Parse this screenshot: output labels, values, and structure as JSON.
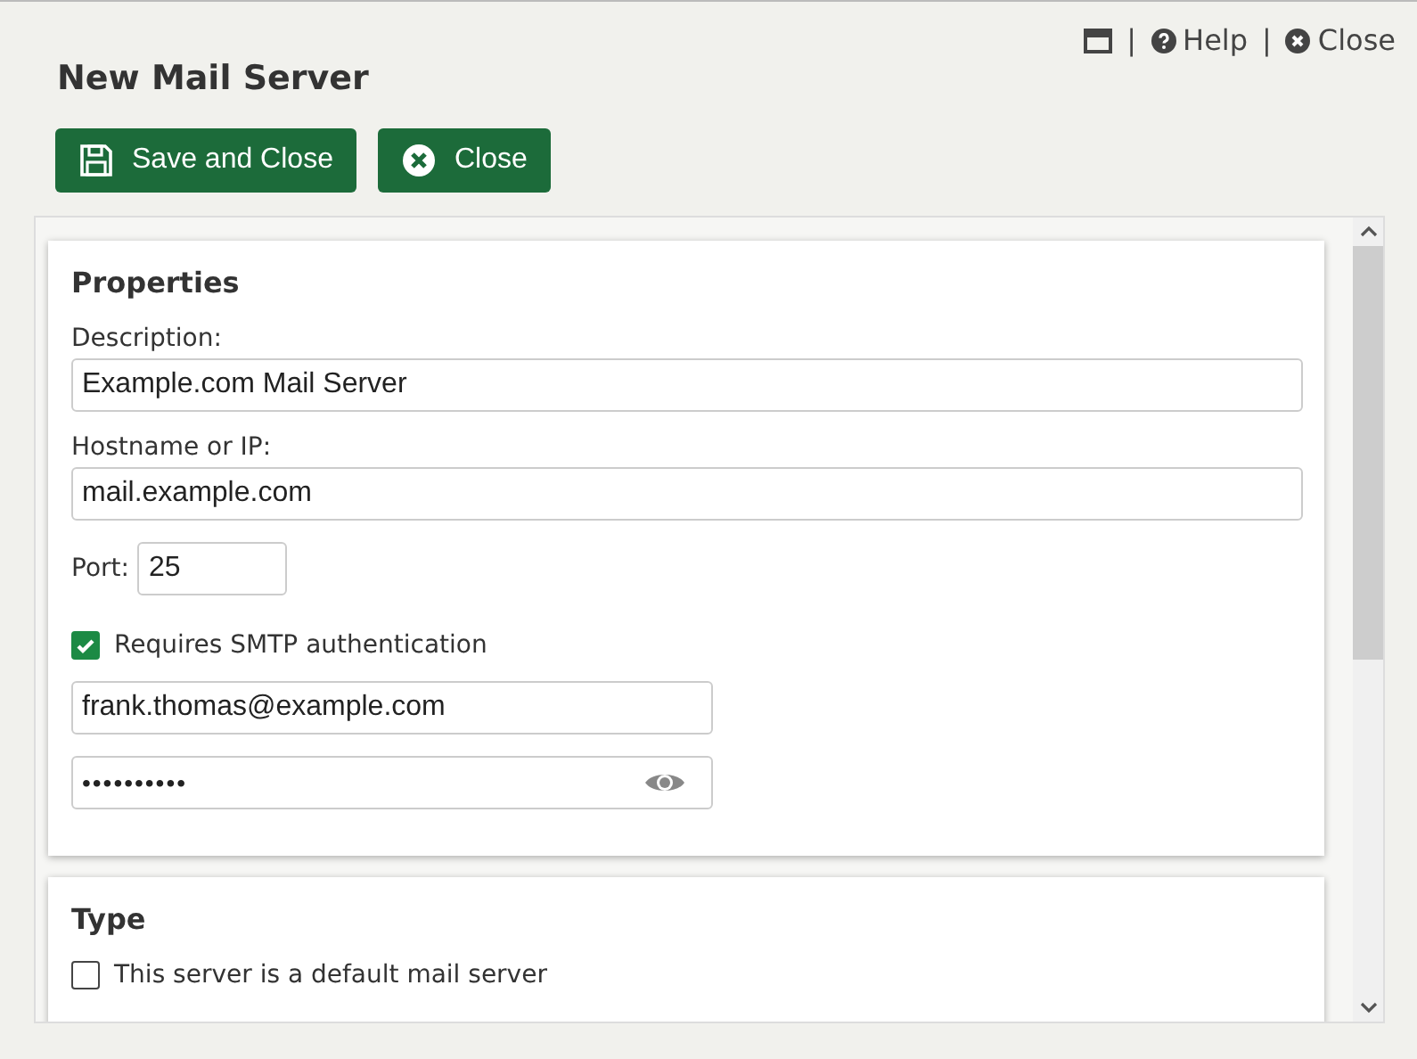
{
  "top_links": [
    {
      "kind": "window"
    },
    {
      "kind": "separator",
      "label": "|"
    },
    {
      "kind": "help",
      "label": "Help"
    },
    {
      "kind": "separator",
      "label": "|"
    },
    {
      "kind": "close",
      "label": "Close"
    }
  ],
  "title": "New Mail Server",
  "buttons": [
    {
      "kind": "save",
      "label": "Save and Close"
    },
    {
      "kind": "close",
      "label": "Close"
    }
  ],
  "properties": {
    "heading": "Properties",
    "description_label": "Description:",
    "description": "Example.com Mail Server",
    "host_label": "Hostname or IP:",
    "host": "mail.example.com",
    "port_label": "Port:",
    "port": "25",
    "auth_label": "Requires SMTP authentication",
    "auth_checked": true,
    "username": "frank.thomas@example.com",
    "password": "••••••••••"
  },
  "type": {
    "heading": "Type",
    "default_label": "This server is a default mail server",
    "default_checked": false
  }
}
